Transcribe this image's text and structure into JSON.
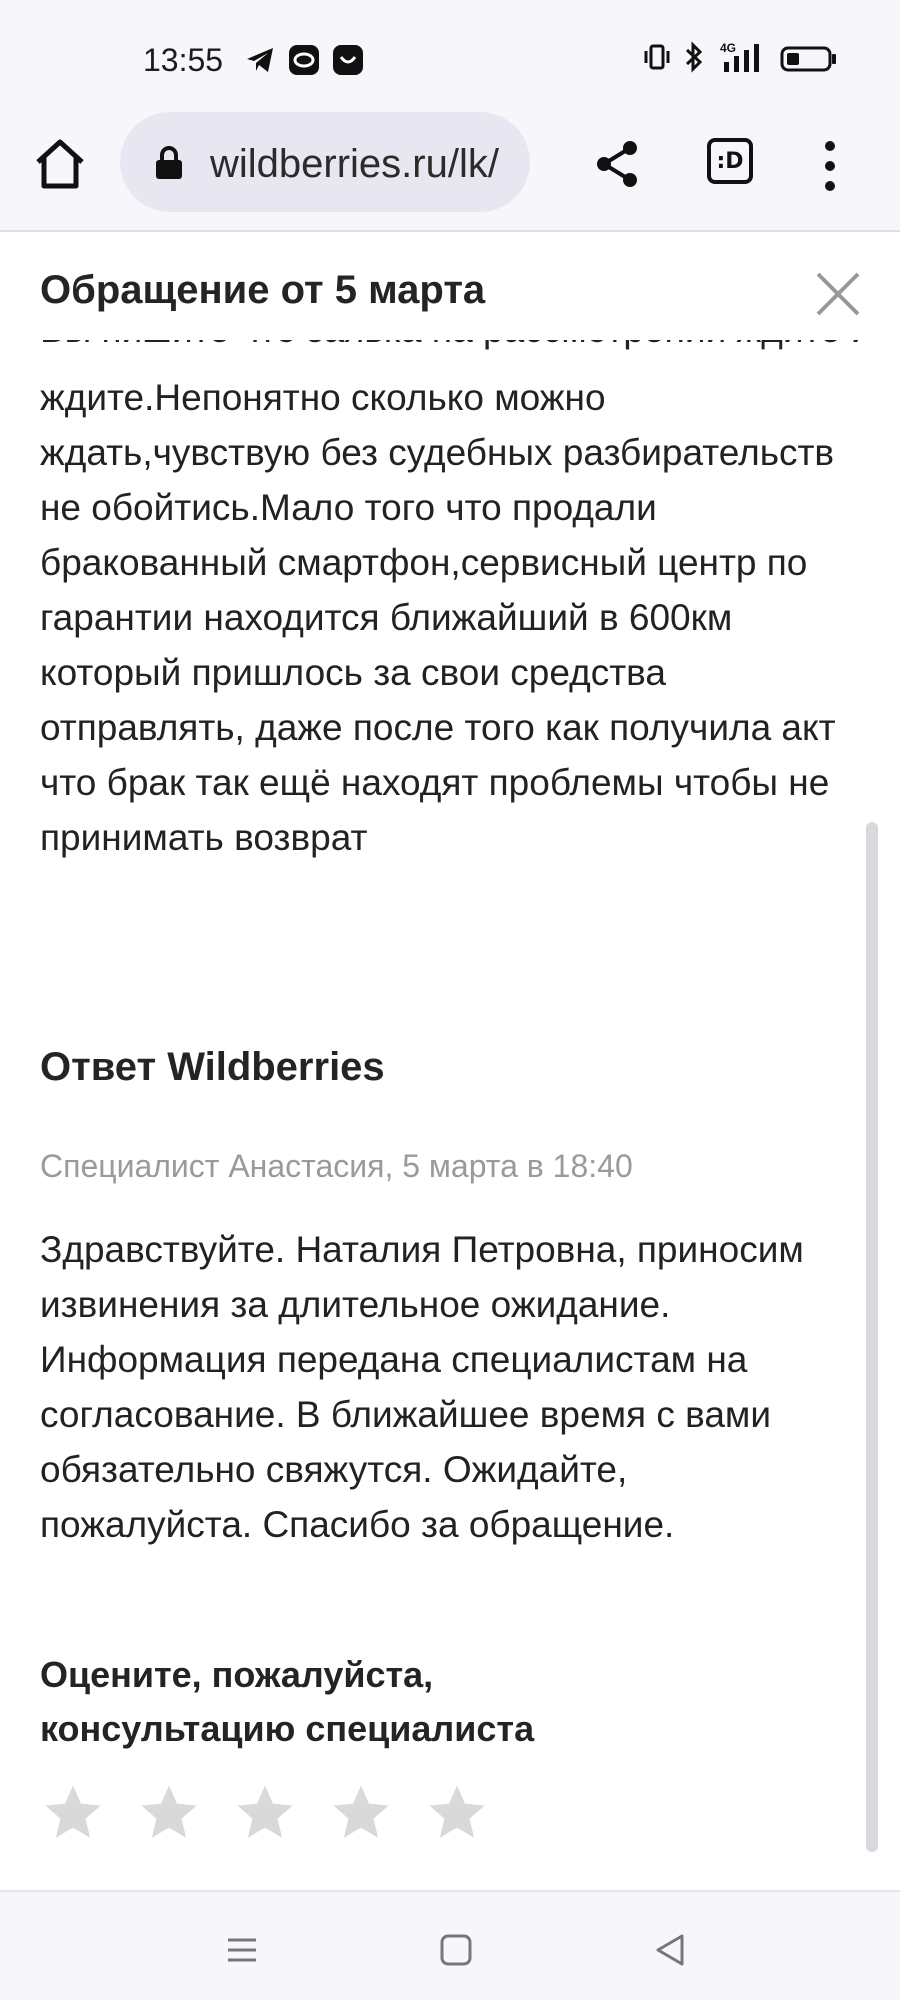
{
  "status_bar": {
    "time": "13:55",
    "left_icons": [
      "telegram-icon",
      "app-icon",
      "smile-app-icon"
    ],
    "network_label": "4G",
    "right_icons": [
      "vibrate-icon",
      "bluetooth-icon",
      "signal-icon",
      "battery-icon"
    ]
  },
  "browser": {
    "url": "wildberries.ru/lk/",
    "tabs_label": ":D",
    "icons": [
      "home-icon",
      "lock-icon",
      "share-icon",
      "menu-icon"
    ]
  },
  "modal": {
    "title": "Обращение от 5 марта",
    "clipped_line": "Вы пишите что заявка на рассмотрении ждите и ждите",
    "complaint_text": "ждите.Непонятно сколько можно ждать,чувствую без судебных разбирательств не обойтись.Мало того что продали бракованный смартфон,сервисный центр по гарантии находится ближайший в 600км который пришлось за свои средства отправлять, даже после того как получила акт что брак так ещё находят проблемы чтобы не принимать возврат",
    "reply_heading": "Ответ Wildberries",
    "reply_meta": "Специалист Анастасия, 5 марта в 18:40",
    "reply_text": "Здравствуйте. Наталия Петровна, приносим извинения за длительное ожидание. Информация передана специалистам на согласование. В ближайшее время с вами обязательно свяжутся. Ожидайте, пожалуйста. Спасибо за обращение.",
    "rate_heading_line1": "Оцените, пожалуйста,",
    "rate_heading_line2": "консультацию специалиста",
    "rating": {
      "max": 5,
      "value": 0
    }
  },
  "colors": {
    "chrome_bg": "#f7f6fb",
    "url_bg": "#e8e7f1",
    "star_empty": "#d9d9d9",
    "meta_text": "#9a9a9a"
  },
  "nav_bar": {
    "icons": [
      "recents-icon",
      "home-square-icon",
      "back-icon"
    ]
  }
}
